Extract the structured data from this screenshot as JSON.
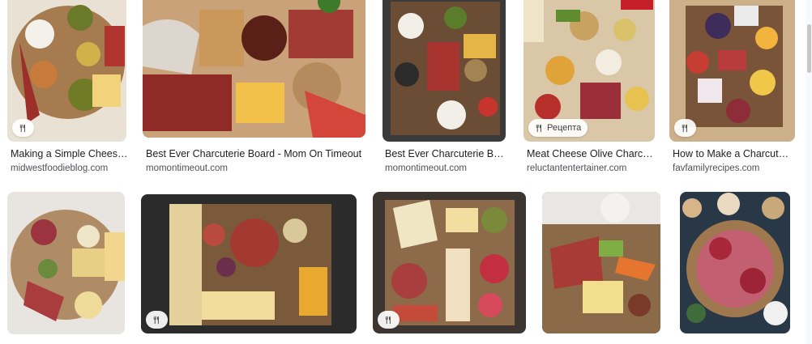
{
  "results": [
    {
      "title": "Making a Simple Chees…",
      "domain": "midwestfoodieblog.com",
      "badge": "",
      "bg": "#e9e1d3"
    },
    {
      "title": "Best Ever Charcuterie Board - Mom On Timeout",
      "domain": "momontimeout.com",
      "badge": "",
      "bg": "#8a6a4a"
    },
    {
      "title": "Best Ever Charcuterie Bo…",
      "domain": "momontimeout.com",
      "badge": "",
      "bg": "#3a3a3a"
    },
    {
      "title": "Meat Cheese Olive Charc…",
      "domain": "reluctantentertainer.com",
      "badge": "Рецепта",
      "bg": "#d9c7a8"
    },
    {
      "title": "How to Make a Charcute…",
      "domain": "favfamilyrecipes.com",
      "badge": "",
      "bg": "#cbb08a"
    },
    {
      "title": "",
      "domain": "",
      "badge": "",
      "bg": "#e8e4df"
    },
    {
      "title": "",
      "domain": "",
      "badge": "",
      "bg": "#2b2b2b"
    },
    {
      "title": "",
      "domain": "",
      "badge": "",
      "bg": "#3d3531"
    },
    {
      "title": "",
      "domain": "",
      "badge": "",
      "bg": "#6b5a4a"
    },
    {
      "title": "",
      "domain": "",
      "badge": "",
      "bg": "#283846"
    }
  ],
  "icons": {
    "recipe": "fork-knife-icon"
  }
}
